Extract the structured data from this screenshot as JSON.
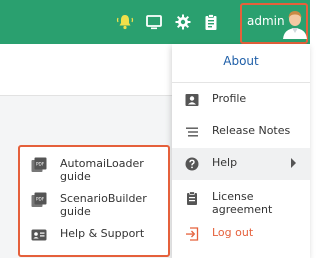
{
  "header": {
    "username": "admin",
    "icons": [
      "bell-icon",
      "monitor-icon",
      "gear-icon",
      "clipboard-icon"
    ],
    "accent_color": "#2aa06f"
  },
  "user_menu": {
    "title": "About",
    "items": [
      {
        "label": "Profile",
        "icon": "id-card-icon"
      },
      {
        "label": "Release Notes",
        "icon": "list-icon"
      },
      {
        "label": "Help",
        "icon": "question-circle-icon",
        "has_submenu": true
      },
      {
        "label": "License agreement",
        "icon": "clipboard-icon"
      },
      {
        "label": "Log out",
        "icon": "logout-icon",
        "color": "#e5603b"
      }
    ]
  },
  "help_submenu": {
    "items": [
      {
        "label": "AutomaiLoader guide",
        "icon": "pdf-icon"
      },
      {
        "label": "ScenarioBuilder guide",
        "icon": "pdf-icon"
      },
      {
        "label": "Help & Support",
        "icon": "contact-card-icon"
      }
    ]
  },
  "highlight_color": "#e5603b"
}
